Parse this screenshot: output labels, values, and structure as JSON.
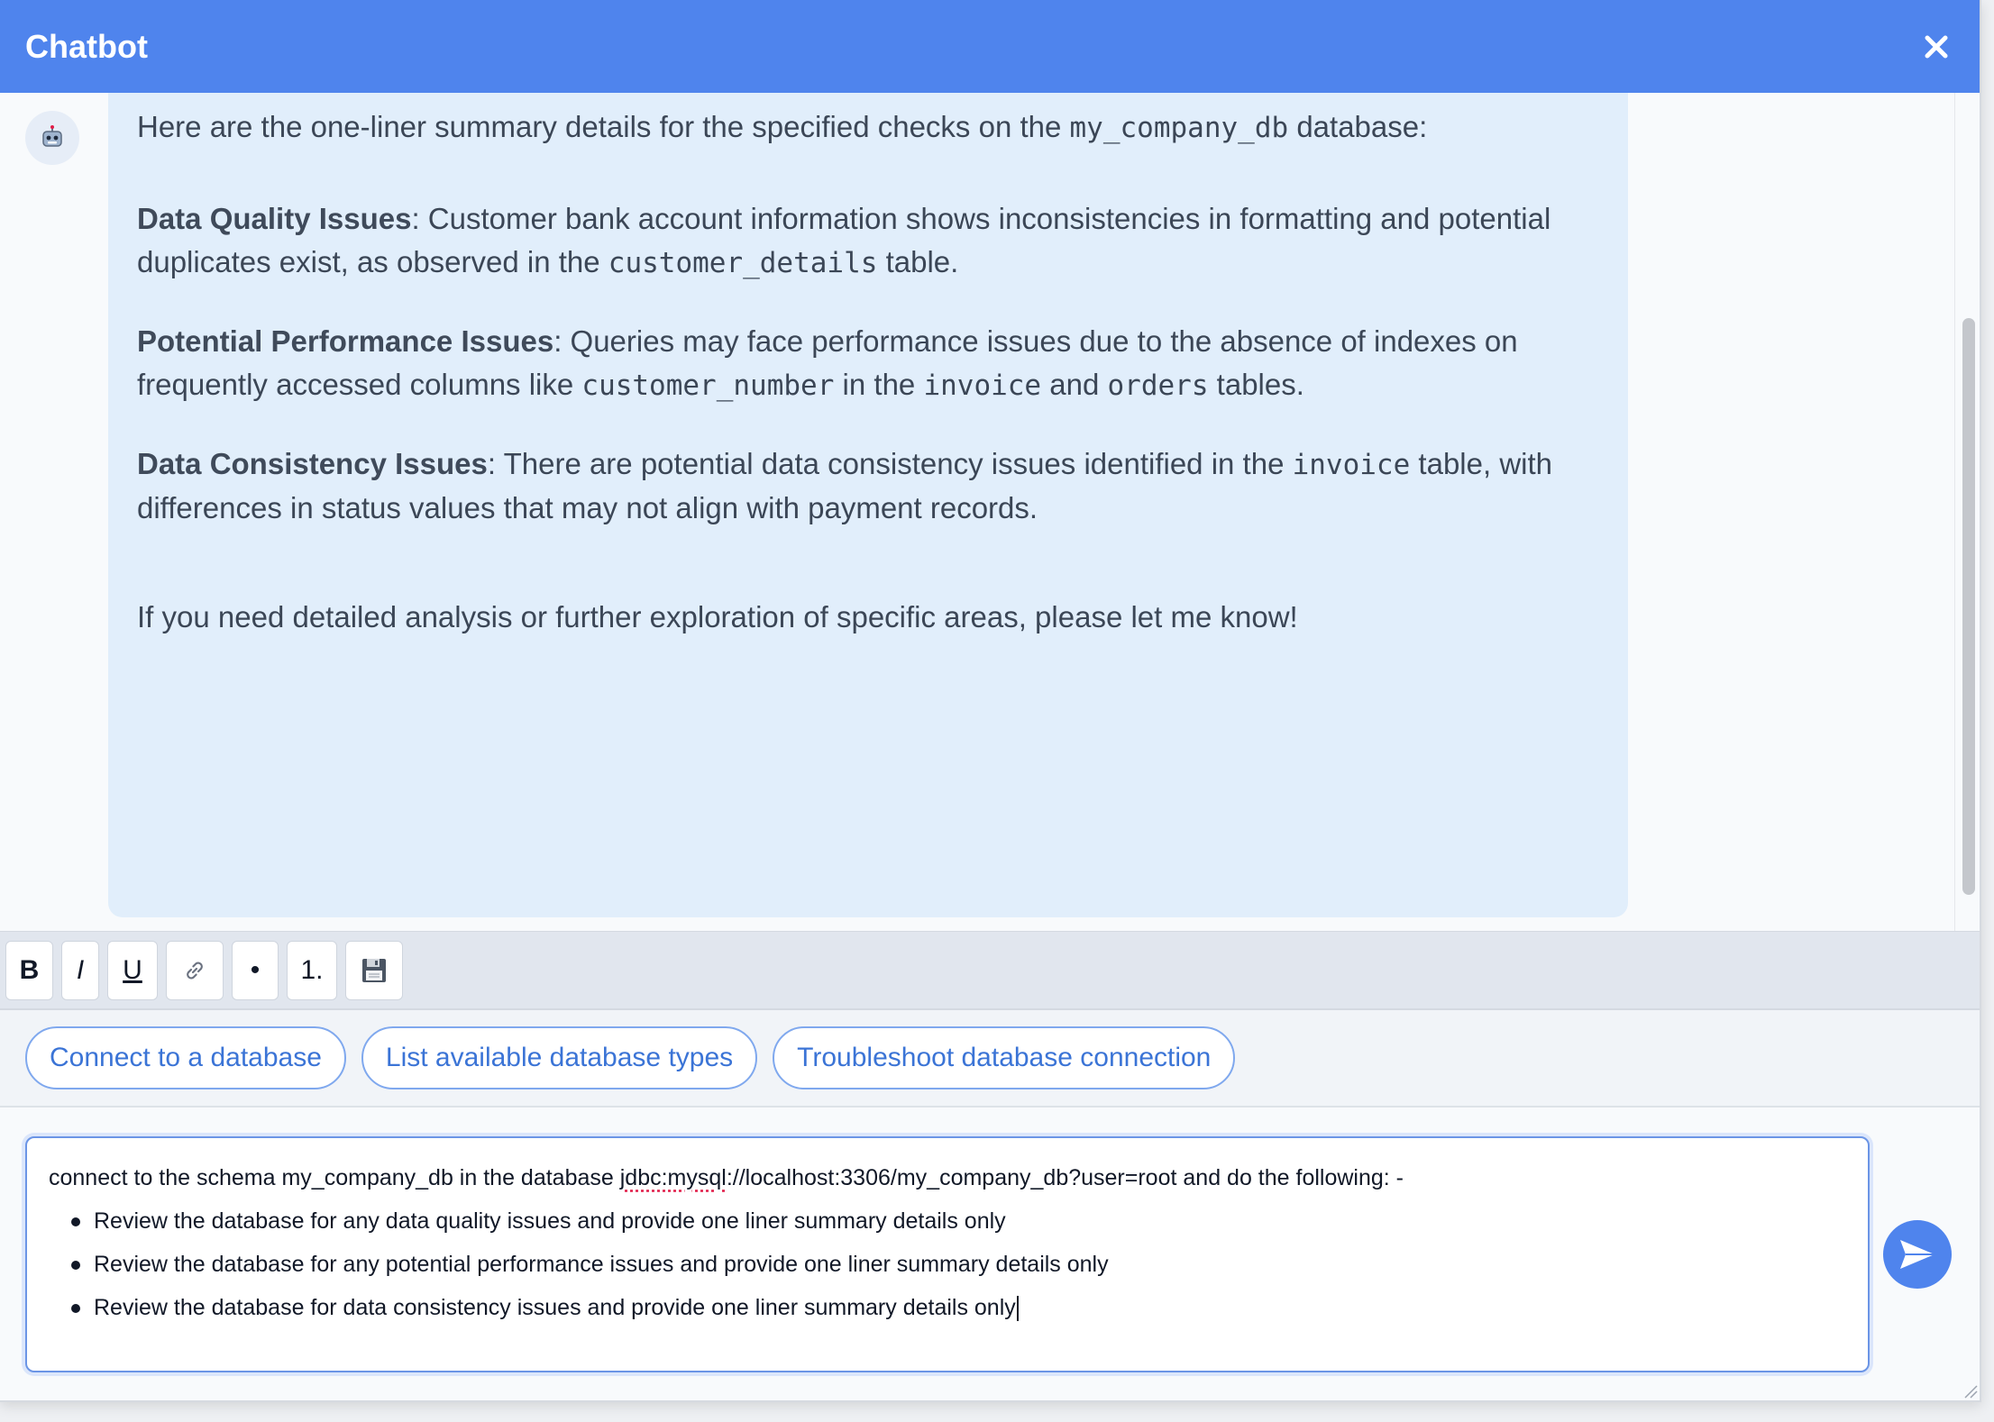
{
  "header": {
    "title": "Chatbot",
    "close_icon": "close-icon"
  },
  "bot_message": {
    "intro_pre": "Here are the one-liner summary details for the specified checks on the ",
    "intro_code": "my_company_db",
    "intro_post": " database:",
    "quality_label": "Data Quality Issues",
    "quality_text_pre": ": Customer bank account information shows inconsistencies in formatting and potential duplicates exist, as observed in the ",
    "quality_code": "customer_details",
    "quality_text_post": " table.",
    "performance_label": "Potential Performance Issues",
    "performance_text_pre": ": Queries may face performance issues due to the absence of indexes on frequently accessed columns like ",
    "performance_code_1": "customer_number",
    "performance_text_mid_1": " in the ",
    "performance_code_2": "invoice",
    "performance_text_mid_2": " and ",
    "performance_code_3": "orders",
    "performance_text_post": " tables.",
    "consistency_label": "Data Consistency Issues",
    "consistency_text_pre": ": There are potential data consistency issues identified in the ",
    "consistency_code": "invoice",
    "consistency_text_post": " table, with differences in status values that may not align with payment records.",
    "closing": "If you need detailed analysis or further exploration of specific areas, please let me know!"
  },
  "toolbar": {
    "bold_label": "B",
    "italic_label": "I",
    "underline_label": "U",
    "bullet_label": "•",
    "numbered_label": "1."
  },
  "suggestions": [
    "Connect to a database",
    "List available database types",
    "Troubleshoot database connection"
  ],
  "composer": {
    "line_pre": "connect to the schema my_company_db in the database ",
    "line_url_flagged": "jdbc:mysql",
    "line_post": "://localhost:3306/my_company_db?user=root and do the following: -",
    "bullets": [
      "Review the database for any data quality issues and provide one liner summary details only",
      "Review the database for any potential performance issues and provide one liner summary details only",
      "Review the database for data consistency issues and provide one liner summary details only"
    ]
  },
  "colors": {
    "accent": "#4f84ed",
    "bubble": "#e1eefb",
    "chip_text": "#3b74d6"
  }
}
